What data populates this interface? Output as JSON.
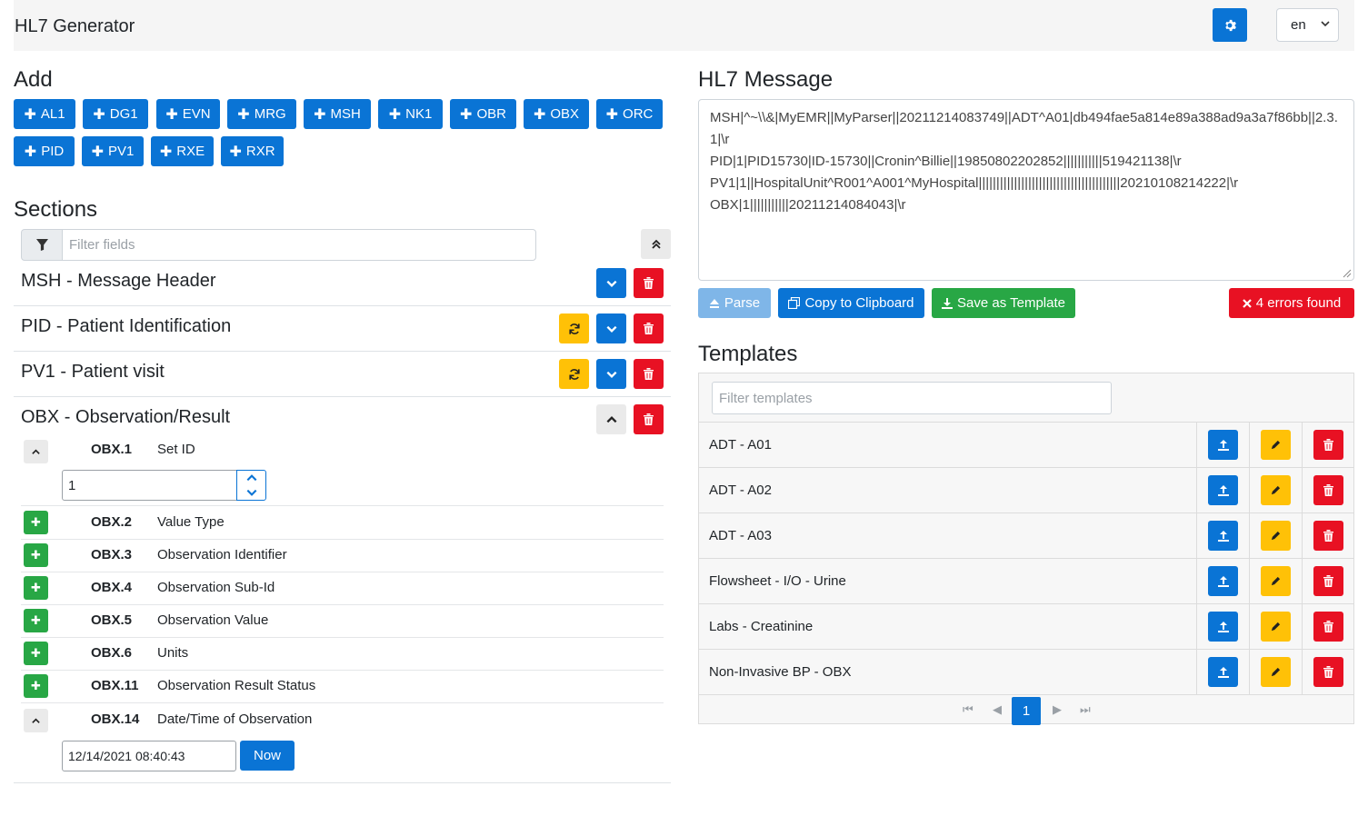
{
  "app": {
    "title": "HL7 Generator",
    "language": "en"
  },
  "icons": {
    "settings": "gear-icon",
    "language_dropdown": "chevron-down-icon"
  },
  "add": {
    "heading": "Add",
    "buttons": [
      "AL1",
      "DG1",
      "EVN",
      "MRG",
      "MSH",
      "NK1",
      "OBR",
      "OBX",
      "ORC",
      "PID",
      "PV1",
      "RXE",
      "RXR"
    ]
  },
  "sections": {
    "heading": "Sections",
    "filter_placeholder": "Filter fields",
    "items": [
      {
        "title": "MSH - Message Header"
      },
      {
        "title": "PID - Patient Identification"
      },
      {
        "title": "PV1 - Patient visit"
      },
      {
        "title": "OBX - Observation/Result"
      }
    ],
    "obx_fields": [
      {
        "code": "OBX.1",
        "label": "Set ID",
        "value": "1"
      },
      {
        "code": "OBX.2",
        "label": "Value Type"
      },
      {
        "code": "OBX.3",
        "label": "Observation Identifier"
      },
      {
        "code": "OBX.4",
        "label": "Observation Sub-Id"
      },
      {
        "code": "OBX.5",
        "label": "Observation Value"
      },
      {
        "code": "OBX.6",
        "label": "Units"
      },
      {
        "code": "OBX.11",
        "label": "Observation Result Status"
      },
      {
        "code": "OBX.14",
        "label": "Date/Time of Observation",
        "value": "12/14/2021 08:40:43"
      }
    ],
    "now_label": "Now"
  },
  "message": {
    "heading": "HL7 Message",
    "lines": [
      "MSH|^~\\\\&|MyEMR||MyParser||20211214083749||ADT^A01|db494fae5a814e89a388ad9a3a7f86bb||2.3.1|\\r",
      "PID|1|PID15730|ID-15730||Cronin^Billie||19850802202852|||||||||||519421138|\\r",
      "PV1|1||HospitalUnit^R001^A001^MyHospital||||||||||||||||||||||||||||||||||||||||20210108214222|\\r",
      "OBX|1|||||||||||20211214084043|\\r"
    ],
    "parse_label": "Parse",
    "copy_label": "Copy to Clipboard",
    "save_label": "Save as Template",
    "errors_label": "4 errors found"
  },
  "templates": {
    "heading": "Templates",
    "filter_placeholder": "Filter templates",
    "items": [
      {
        "name": "ADT - A01"
      },
      {
        "name": "ADT - A02"
      },
      {
        "name": "ADT - A03"
      },
      {
        "name": "Flowsheet - I/O - Urine"
      },
      {
        "name": "Labs - Creatinine"
      },
      {
        "name": "Non-Invasive BP - OBX"
      }
    ],
    "current_page": "1"
  },
  "colors": {
    "primary": "#0a74d5",
    "success": "#28a745",
    "danger": "#e81123",
    "warning": "#ffc107"
  }
}
